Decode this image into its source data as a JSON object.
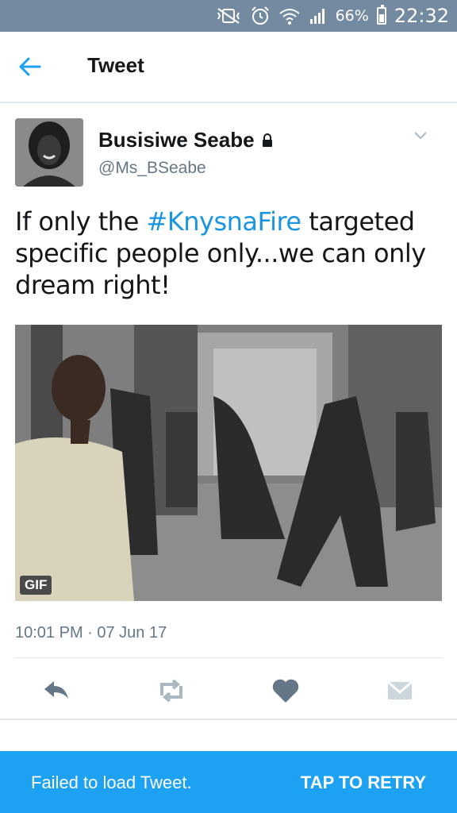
{
  "status_bar": {
    "battery": "66%",
    "time": "22:32",
    "icons": [
      "mute-vibrate-icon",
      "alarm-icon",
      "wifi-icon",
      "signal-icon",
      "battery-icon"
    ]
  },
  "header": {
    "title": "Tweet",
    "back_icon": "arrow-left-icon"
  },
  "tweet": {
    "author": {
      "name": "Busisiwe Seabe",
      "handle": "@Ms_BSeabe",
      "protected_icon": "lock-icon"
    },
    "text_before": "If only the ",
    "hashtag": "#KnysnaFire",
    "text_after": " targeted specific people only...we can only dream right!",
    "media": {
      "badge": "GIF"
    },
    "timestamp": "10:01 PM · 07 Jun 17"
  },
  "actions": [
    "reply-icon",
    "retweet-icon",
    "like-icon",
    "direct-message-icon"
  ],
  "banner": {
    "message": "Failed to load Tweet.",
    "retry_label": "TAP TO RETRY"
  },
  "colors": {
    "status_bar": "#738aa0",
    "link": "#1b95e0",
    "banner": "#1da1f2",
    "icon_gray": "#657786"
  }
}
